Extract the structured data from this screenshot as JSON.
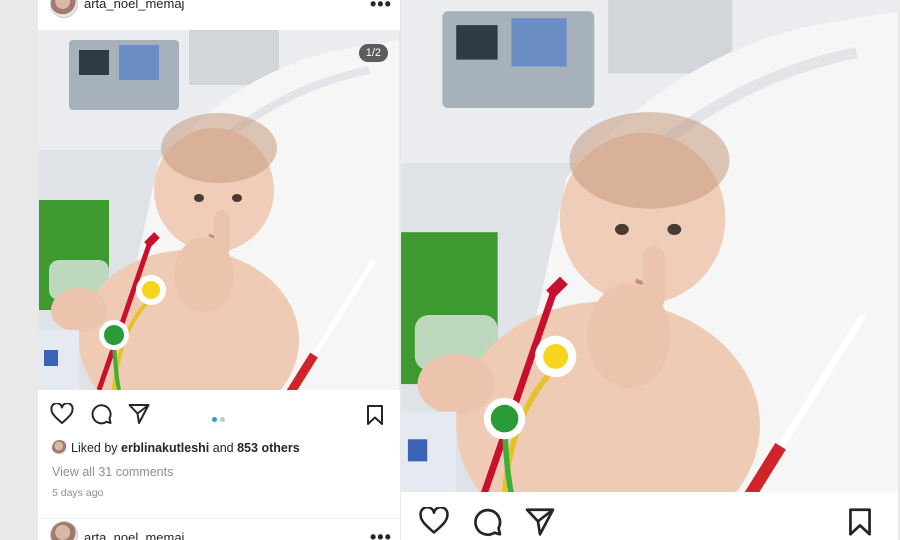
{
  "left_post": {
    "username": "arta_noel_memaj",
    "more_label": "•••",
    "slide_counter": "1/2",
    "likes": {
      "prefix": "Liked by",
      "liker": "erblinakutleshi",
      "joiner": "and",
      "count": "853 others"
    },
    "comments_link": "View all 31 comments",
    "timestamp": "5 days ago",
    "carousel": {
      "total": 2,
      "active": 1,
      "active_color": "#3897f0",
      "inactive_color": "#c7c7c7"
    },
    "next_username": "arta_noel_memaj",
    "next_more_label": "•••"
  },
  "right_post": {
    "icons": [
      "heart-icon",
      "comment-icon",
      "share-icon",
      "bookmark-icon"
    ]
  },
  "icons": {
    "heart": "heart-icon",
    "comment": "comment-icon",
    "share": "share-icon",
    "bookmark": "bookmark-icon",
    "more": "more-icon"
  },
  "colors": {
    "text": "#262626",
    "muted": "#8e8e8e",
    "accent": "#3897f0"
  }
}
